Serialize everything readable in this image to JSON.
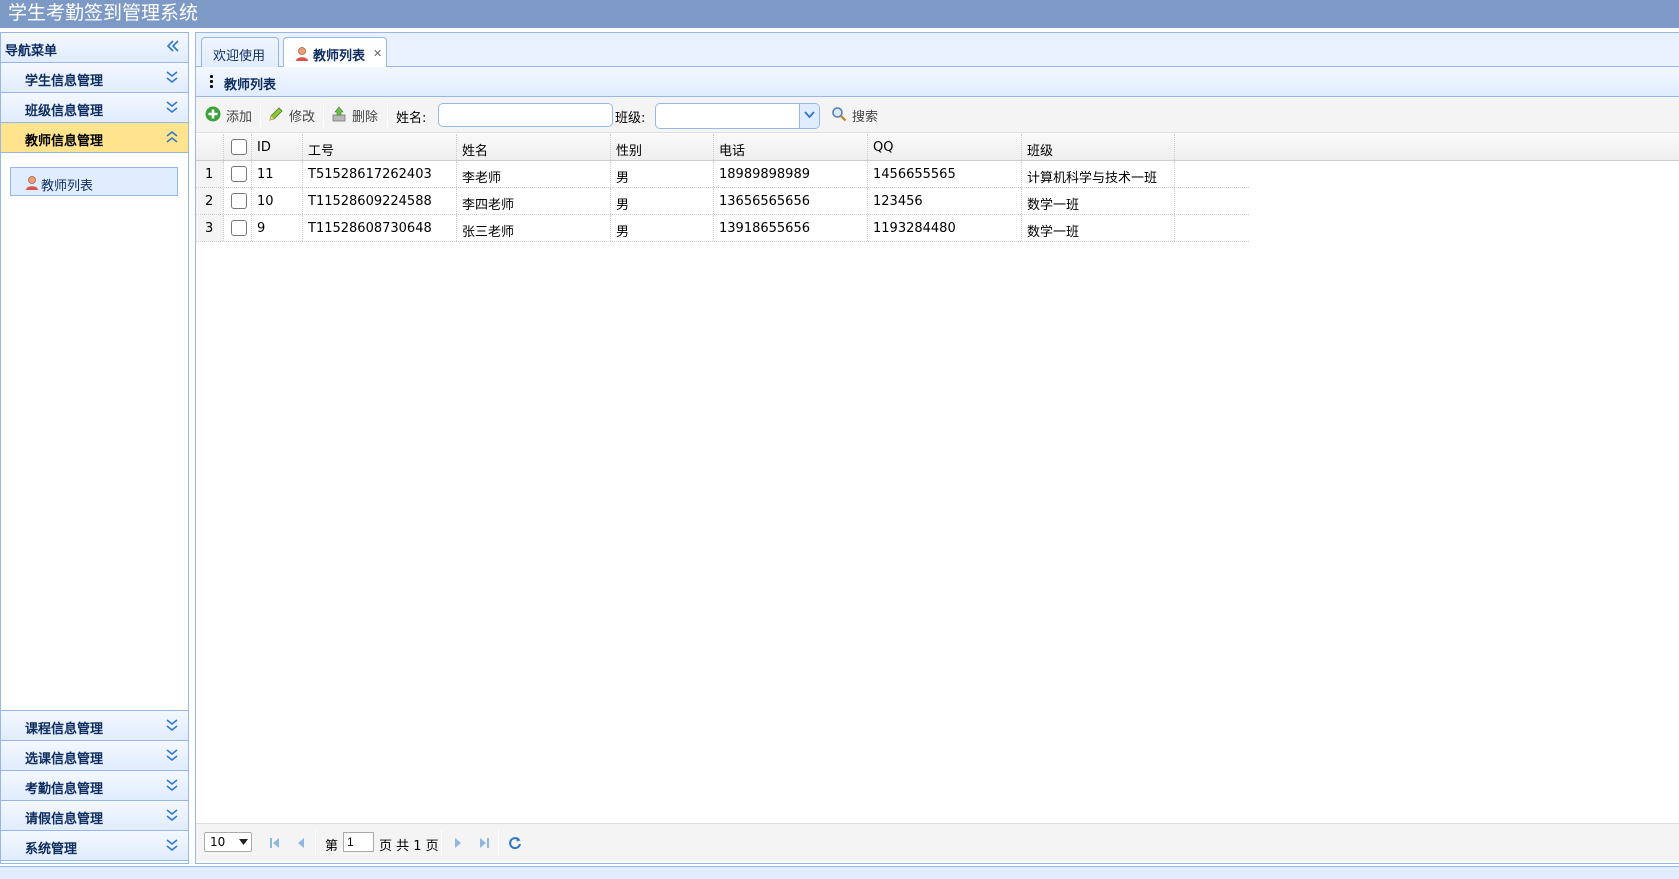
{
  "app": {
    "title": "学生考勤签到管理系统"
  },
  "sidebar": {
    "header": "导航菜单",
    "top_items": [
      {
        "label": "学生信息管理"
      },
      {
        "label": "班级信息管理"
      },
      {
        "label": "教师信息管理",
        "active": true
      }
    ],
    "tree": [
      {
        "label": "教师列表"
      }
    ],
    "bottom_items": [
      {
        "label": "课程信息管理"
      },
      {
        "label": "选课信息管理"
      },
      {
        "label": "考勤信息管理"
      },
      {
        "label": "请假信息管理"
      },
      {
        "label": "系统管理"
      }
    ]
  },
  "tabs": [
    {
      "label": "欢迎使用"
    },
    {
      "label": "教师列表",
      "active": true,
      "closable": true
    }
  ],
  "panel": {
    "title": "教师列表"
  },
  "toolbar": {
    "add": "添加",
    "edit": "修改",
    "delete": "删除",
    "name_label": "姓名:",
    "name_value": "",
    "class_label": "班级:",
    "class_value": "",
    "search": "搜索"
  },
  "grid": {
    "columns": [
      "ID",
      "工号",
      "姓名",
      "性别",
      "电话",
      "QQ",
      "班级"
    ],
    "rows": [
      {
        "num": "1",
        "cells": [
          "11",
          "T51528617262403",
          "李老师",
          "男",
          "18989898989",
          "1456655565",
          "计算机科学与技术一班"
        ]
      },
      {
        "num": "2",
        "cells": [
          "10",
          "T11528609224588",
          "李四老师",
          "男",
          "13656565656",
          "123456",
          "数学一班"
        ]
      },
      {
        "num": "3",
        "cells": [
          "9",
          "T11528608730648",
          "张三老师",
          "男",
          "13918655656",
          "1193284480",
          "数学一班"
        ]
      }
    ]
  },
  "pager": {
    "page_size": "10",
    "page_prefix": "第",
    "page_value": "1",
    "page_suffix": "页 共 1 页"
  },
  "colors": {
    "header_bg": "#7d99c5",
    "border": "#95b8e7",
    "active_menu": "#ffe48d"
  },
  "icons": [
    "double-chevron-left-icon",
    "double-chevron-down-icon",
    "double-chevron-up-icon",
    "user-icon",
    "close-icon",
    "add-icon",
    "edit-icon",
    "delete-icon",
    "search-icon",
    "first-page-icon",
    "prev-page-icon",
    "next-page-icon",
    "last-page-icon",
    "refresh-icon"
  ]
}
